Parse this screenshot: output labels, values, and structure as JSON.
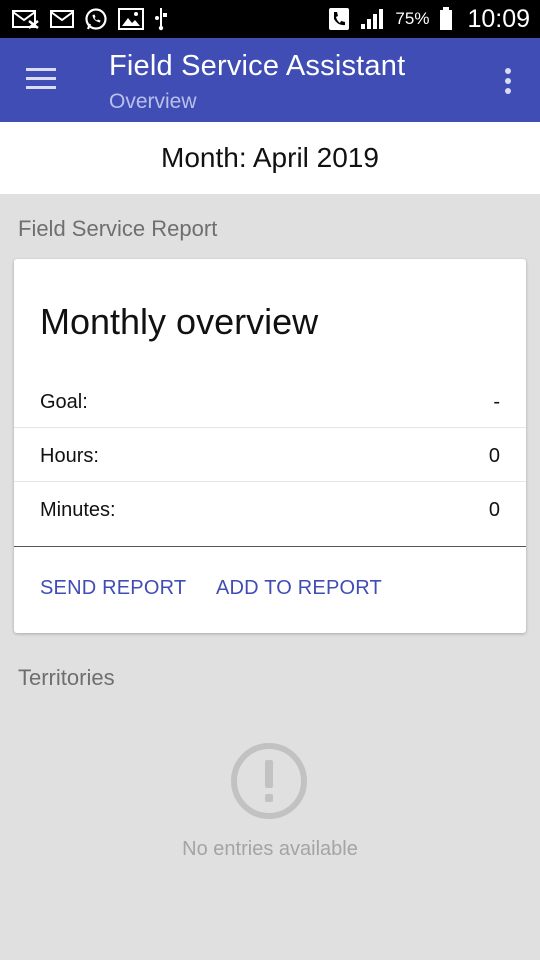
{
  "status_bar": {
    "icons_left": [
      "missed-message-icon",
      "email-icon",
      "whatsapp-icon",
      "image-icon",
      "usb-icon"
    ],
    "battery": "75%",
    "time": "10:09"
  },
  "app_bar": {
    "title": "Field Service Assistant",
    "subtitle": "Overview",
    "color": "#3f4db5"
  },
  "month_bar": {
    "label": "Month: April 2019"
  },
  "sections": {
    "report_header": "Field Service Report",
    "territories_header": "Territories"
  },
  "card": {
    "title": "Monthly overview",
    "rows": [
      {
        "label": "Goal:",
        "value": "-"
      },
      {
        "label": "Hours:",
        "value": "0"
      },
      {
        "label": "Minutes:",
        "value": "0"
      }
    ],
    "actions": {
      "send": "SEND REPORT",
      "add": "ADD TO REPORT"
    }
  },
  "empty_state": {
    "icon": "alert-circle-icon",
    "text": "No entries available"
  }
}
